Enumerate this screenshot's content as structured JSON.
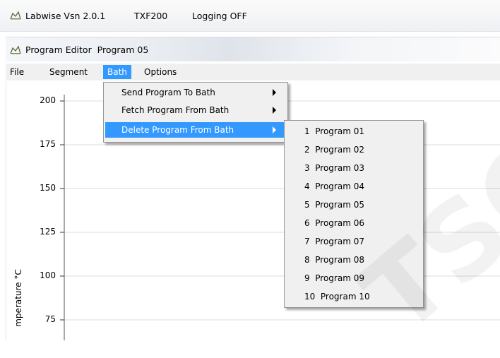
{
  "app": {
    "title": "Labwise Vsn 2.0.1",
    "device": "TXF200",
    "logging": "Logging OFF"
  },
  "editor": {
    "title": "Program Editor  Program 05"
  },
  "menubar": {
    "items": [
      "File",
      "Segment",
      "Bath",
      "Options"
    ],
    "active": "Bath"
  },
  "bath_menu": {
    "items": [
      {
        "label": "Send Program To Bath"
      },
      {
        "label": "Fetch Program From Bath"
      },
      {
        "label": "Delete Program From Bath"
      }
    ],
    "highlighted": "Delete Program From Bath"
  },
  "delete_submenu": {
    "items": [
      "1  Program 01",
      "2  Program 02",
      "3  Program 03",
      "4  Program 04",
      "5  Program 05",
      "6  Program 06",
      "7  Program 07",
      "8  Program 08",
      "9  Program 09",
      "10  Program 10"
    ]
  },
  "chart_data": {
    "type": "line",
    "ylabel": "mperature °C",
    "y_ticks": [
      "200",
      "175",
      "150",
      "125",
      "100",
      "75"
    ],
    "grid": true
  },
  "colors": {
    "highlight": "#3399ff",
    "menu_bg": "#f0f0f0",
    "grid": "#dcdcdc"
  }
}
